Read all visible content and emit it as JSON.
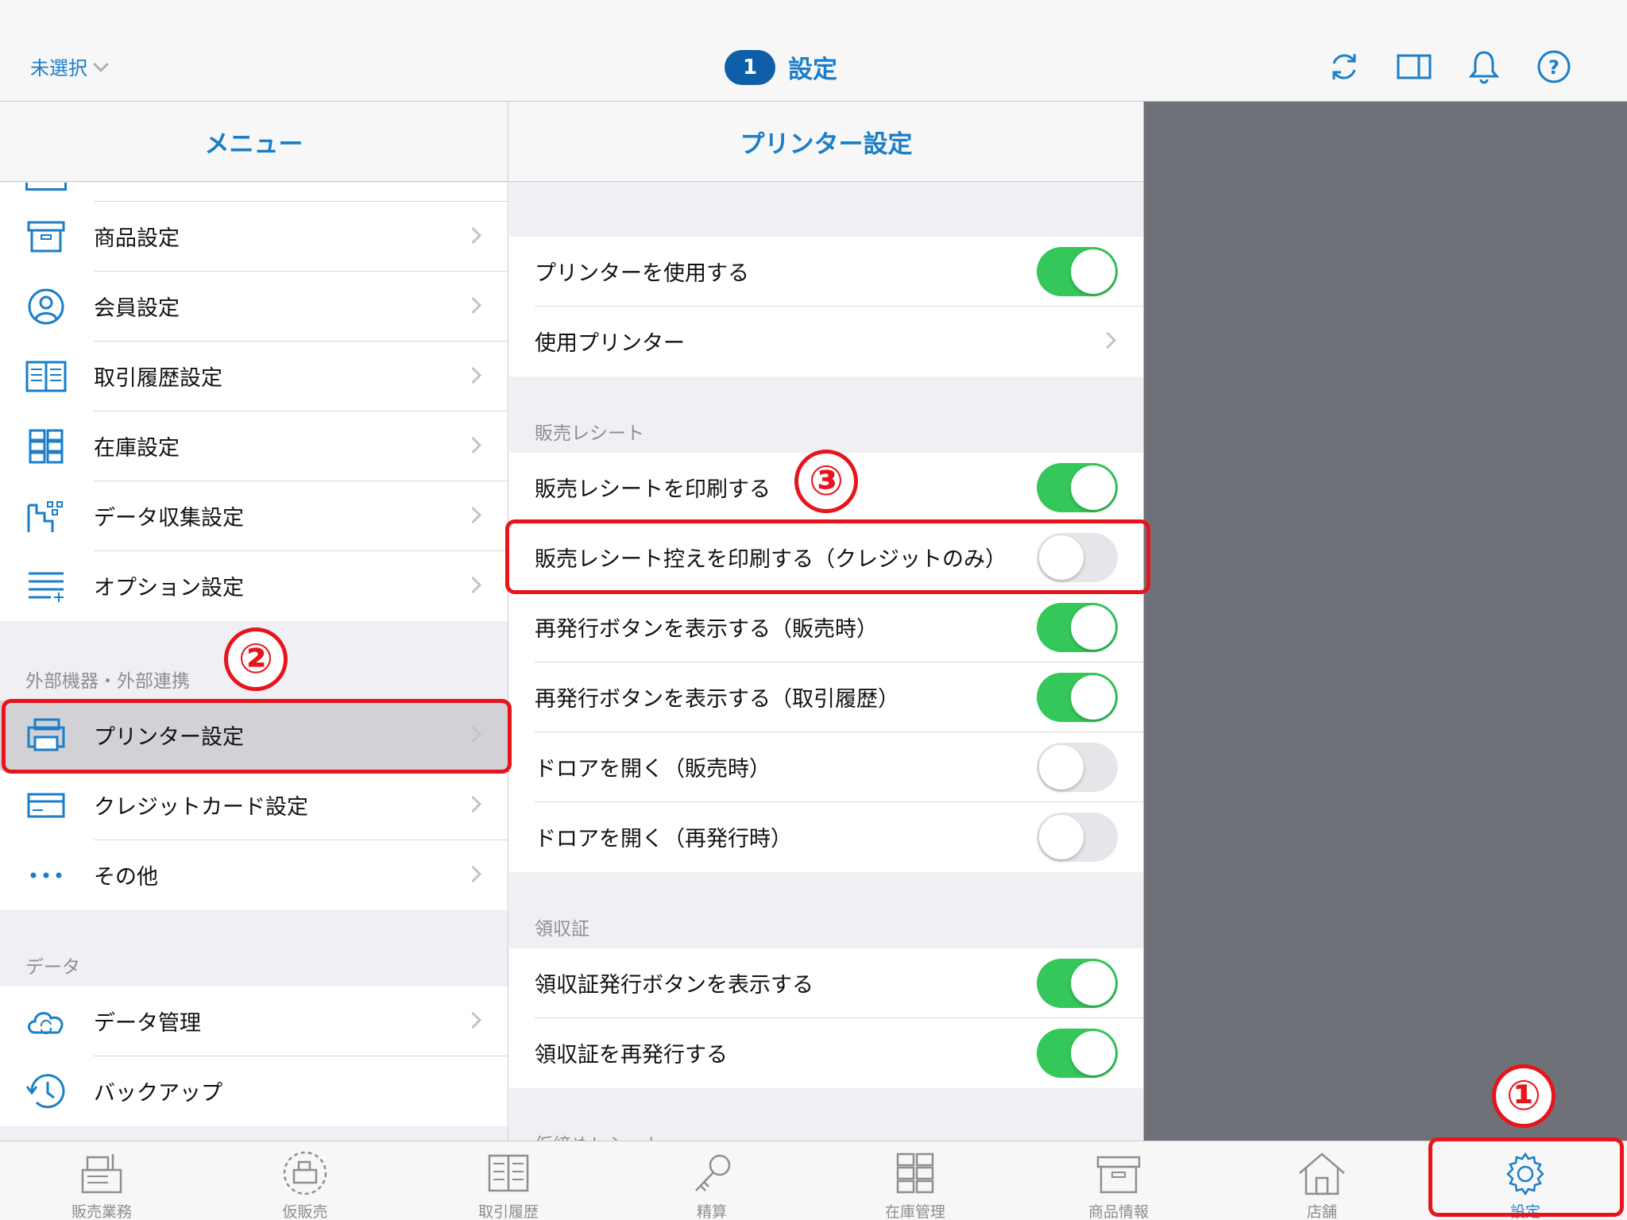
{
  "header": {
    "store_select": "未選択",
    "badge": "1",
    "title": "設定"
  },
  "menu": {
    "title": "メニュー",
    "items_top": [
      {
        "label": "商品設定",
        "icon": "box-icon"
      },
      {
        "label": "会員設定",
        "icon": "person-icon"
      },
      {
        "label": "取引履歴設定",
        "icon": "book-icon"
      },
      {
        "label": "在庫設定",
        "icon": "cabinet-icon"
      },
      {
        "label": "データ収集設定",
        "icon": "data-collect-icon"
      },
      {
        "label": "オプション設定",
        "icon": "list-plus-icon"
      }
    ],
    "section_external": "外部機器・外部連携",
    "items_external": [
      {
        "label": "プリンター設定",
        "icon": "printer-icon"
      },
      {
        "label": "クレジットカード設定",
        "icon": "credit-card-icon"
      },
      {
        "label": "その他",
        "icon": "more-icon"
      }
    ],
    "section_data": "データ",
    "items_data": [
      {
        "label": "データ管理",
        "icon": "cloud-sync-icon"
      },
      {
        "label": "バックアップ",
        "icon": "history-icon"
      }
    ]
  },
  "detail": {
    "title": "プリンター設定",
    "rows_top": [
      {
        "label": "プリンターを使用する",
        "toggle": true
      },
      {
        "label": "使用プリンター"
      }
    ],
    "section_sales": "販売レシート",
    "rows_sales": [
      {
        "label": "販売レシートを印刷する",
        "toggle": true
      },
      {
        "label": "販売レシート控えを印刷する（クレジットのみ）",
        "toggle": false
      },
      {
        "label": "再発行ボタンを表示する（販売時）",
        "toggle": true
      },
      {
        "label": "再発行ボタンを表示する（取引履歴）",
        "toggle": true
      },
      {
        "label": "ドロアを開く（販売時）",
        "toggle": false
      },
      {
        "label": "ドロアを開く（再発行時）",
        "toggle": false
      }
    ],
    "section_receipt": "領収証",
    "rows_receipt": [
      {
        "label": "領収証発行ボタンを表示する",
        "toggle": true
      },
      {
        "label": "領収証を再発行する",
        "toggle": true
      }
    ],
    "section_next_partial": "仮締めレシート"
  },
  "tabs": [
    {
      "label": "販売業務",
      "icon": "register-icon"
    },
    {
      "label": "仮販売",
      "icon": "temp-sale-icon"
    },
    {
      "label": "取引履歴",
      "icon": "history-book-icon"
    },
    {
      "label": "精算",
      "icon": "key-icon"
    },
    {
      "label": "在庫管理",
      "icon": "cabinet-icon"
    },
    {
      "label": "商品情報",
      "icon": "box-icon"
    },
    {
      "label": "店舗",
      "icon": "store-icon"
    },
    {
      "label": "設定",
      "icon": "gear-icon",
      "active": true
    }
  ],
  "annotations": [
    "①",
    "②",
    "③"
  ],
  "colors": {
    "accent": "#1a7ec8",
    "toggle_on": "#34c759",
    "annotation_red": "#e8141c"
  }
}
